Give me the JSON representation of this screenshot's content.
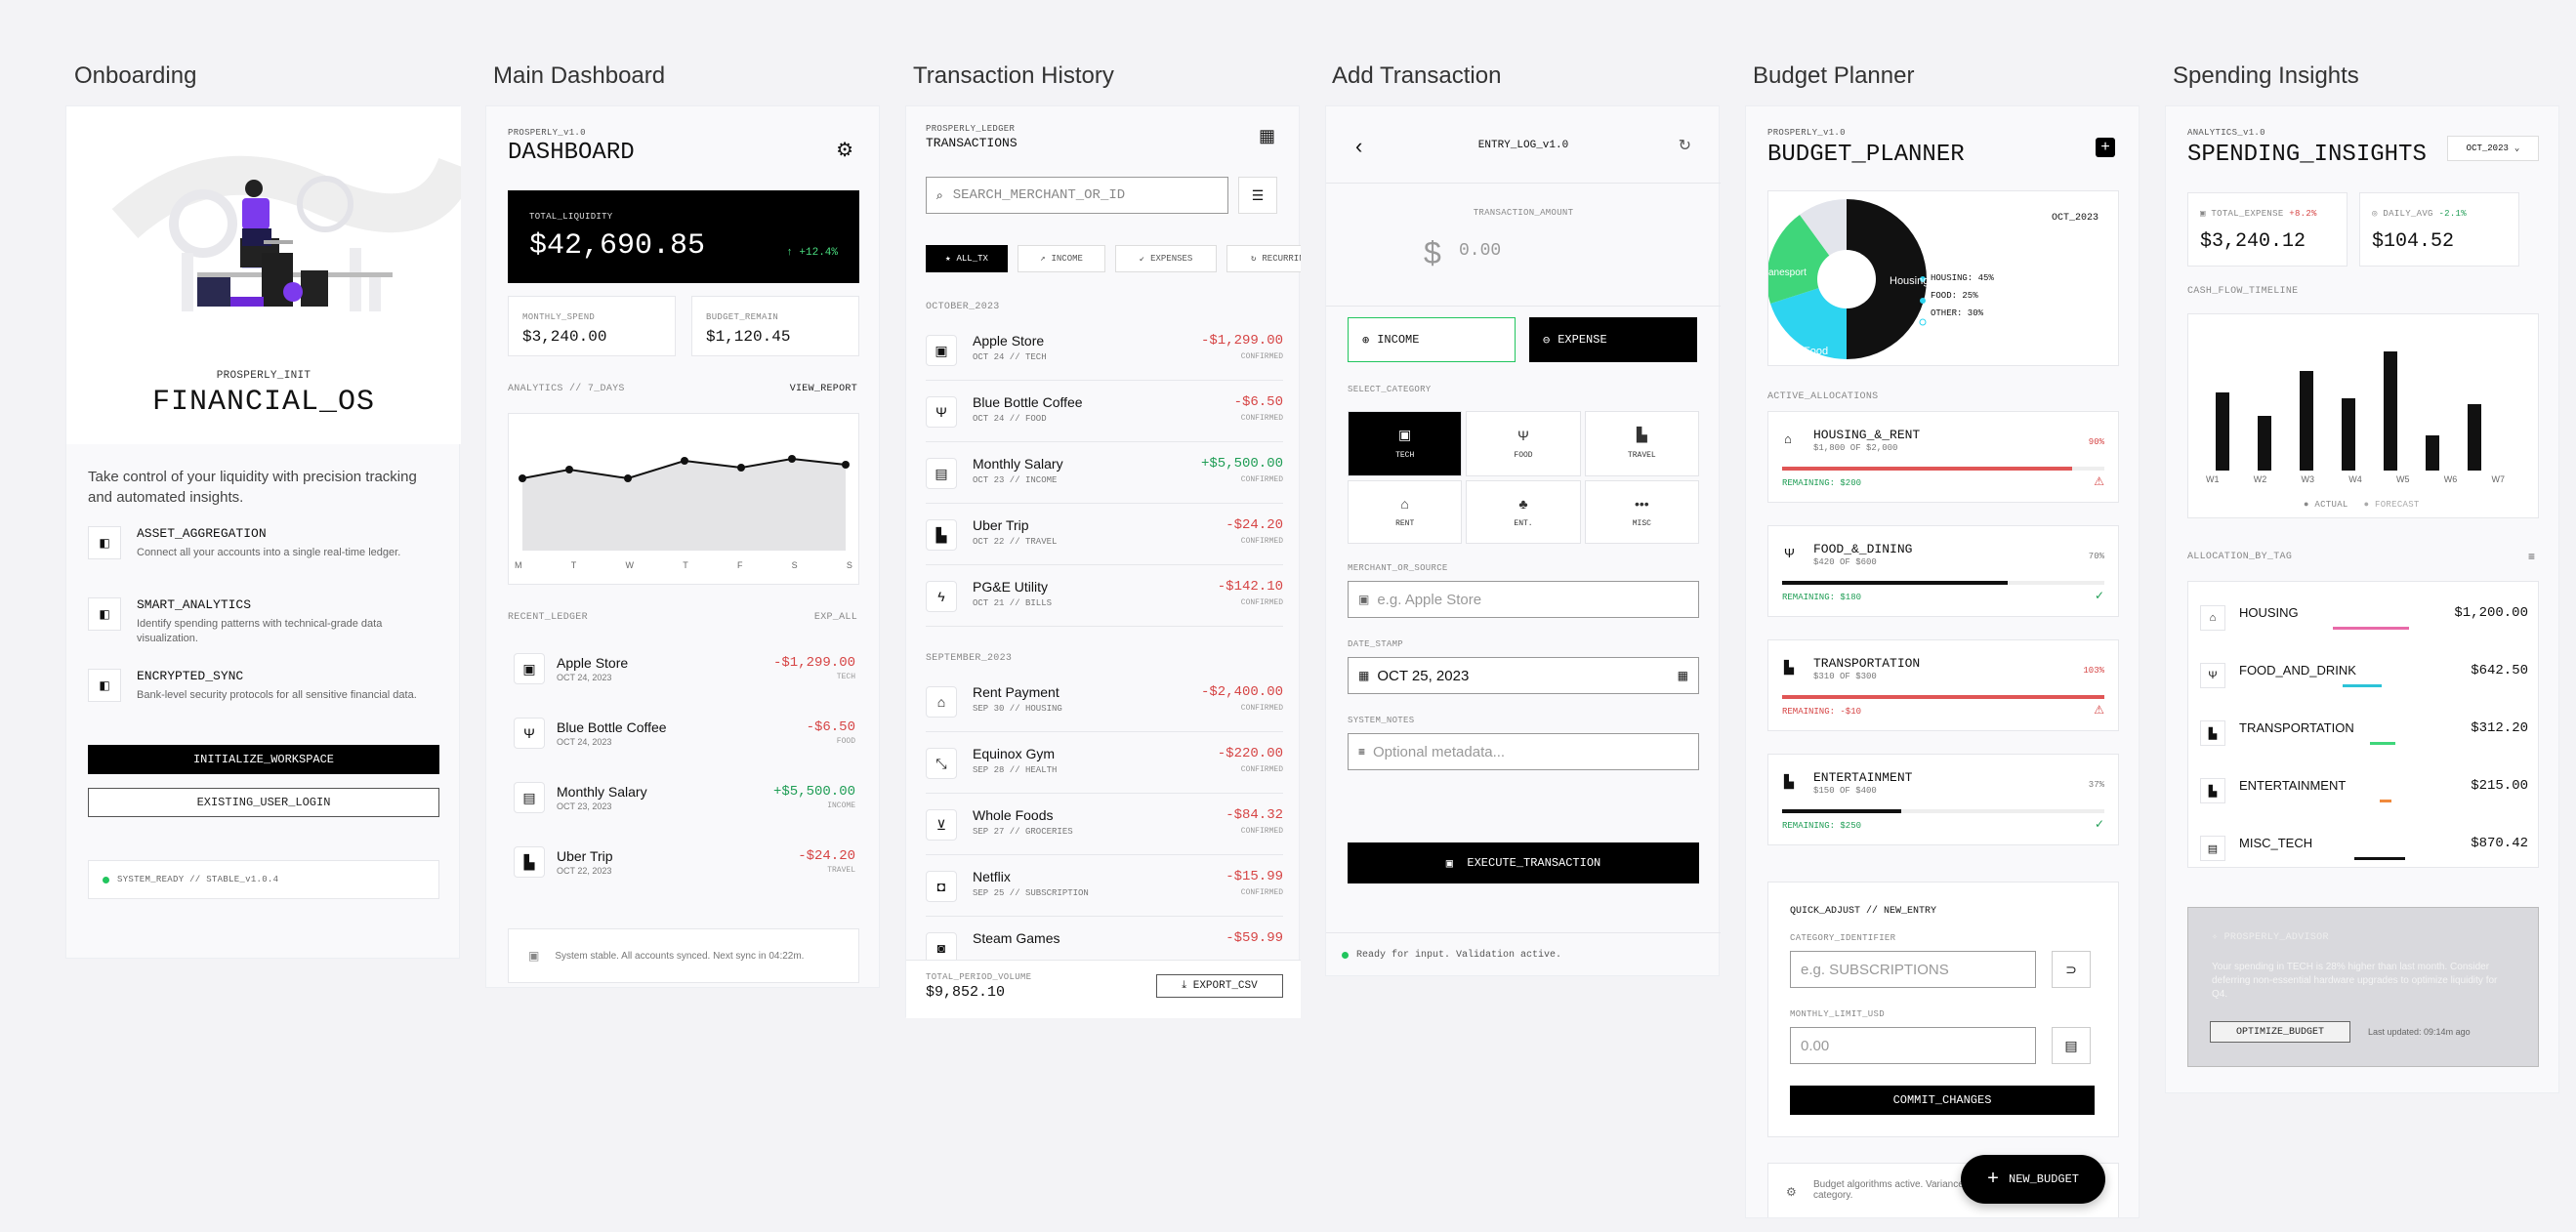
{
  "columns": {
    "onboarding": "Onboarding",
    "dashboard": "Main Dashboard",
    "history": "Transaction History",
    "add": "Add Transaction",
    "budget": "Budget Planner",
    "insights": "Spending Insights"
  },
  "onboarding": {
    "init_label": "PROSPERLY_INIT",
    "title": "FINANCIAL_OS",
    "intro": "Take control of your liquidity with precision tracking and automated insights.",
    "features": [
      {
        "icon": "wallet-icon",
        "title": "ASSET_AGGREGATION",
        "desc": "Connect all your accounts into a single real-time ledger."
      },
      {
        "icon": "chart-icon",
        "title": "SMART_ANALYTICS",
        "desc": "Identify spending patterns with technical-grade data visualization."
      },
      {
        "icon": "shield-icon",
        "title": "ENCRYPTED_SYNC",
        "desc": "Bank-level security protocols for all sensitive financial data."
      }
    ],
    "primary_btn": "INITIALIZE_WORKSPACE",
    "secondary_btn": "EXISTING_USER_LOGIN",
    "status": "SYSTEM_READY // STABLE_v1.0.4"
  },
  "dashboard": {
    "brand": "PROSPERLY_v1.0",
    "title": "DASHBOARD",
    "liq_label": "TOTAL_LIQUIDITY",
    "liq_value": "$42,690.85",
    "liq_change": "+12.4%",
    "spend_label": "MONTHLY_SPEND",
    "spend_value": "$3,240.00",
    "remain_label": "BUDGET_REMAIN",
    "remain_value": "$1,120.45",
    "analytics_label": "ANALYTICS // 7_DAYS",
    "view_report": "VIEW_REPORT",
    "days": [
      "M",
      "T",
      "W",
      "T",
      "F",
      "S",
      "S"
    ],
    "ledger_label": "RECENT_LEDGER",
    "exp_all": "EXP_ALL",
    "ledger": [
      {
        "icon": "bag-icon",
        "glyph": "▣",
        "name": "Apple Store",
        "date": "OCT 24, 2023",
        "amount": "-$1,299.00",
        "tag": "TECH",
        "neg": true
      },
      {
        "icon": "utensils-icon",
        "glyph": "Ψ",
        "name": "Blue Bottle Coffee",
        "date": "OCT 24, 2023",
        "amount": "-$6.50",
        "tag": "FOOD",
        "neg": true
      },
      {
        "icon": "money-icon",
        "glyph": "▤",
        "name": "Monthly Salary",
        "date": "OCT 23, 2023",
        "amount": "+$5,500.00",
        "tag": "INCOME",
        "neg": false
      },
      {
        "icon": "car-icon",
        "glyph": "▙",
        "name": "Uber Trip",
        "date": "OCT 22, 2023",
        "amount": "-$24.20",
        "tag": "TRAVEL",
        "neg": true
      }
    ],
    "footer": "System stable. All accounts synced. Next sync in 04:22m."
  },
  "history": {
    "brand": "PROSPERLY_LEDGER",
    "title": "TRANSACTIONS",
    "search_placeholder": "SEARCH_MERCHANT_OR_ID",
    "filters": [
      "ALL_TX",
      "INCOME",
      "EXPENSES",
      "RECURRING"
    ],
    "oct_label": "OCTOBER_2023",
    "oct": [
      {
        "glyph": "▣",
        "name": "Apple Store",
        "date": "OCT 24 // TECH",
        "amount": "-$1,299.00",
        "status": "CONFIRMED",
        "neg": true
      },
      {
        "glyph": "Ψ",
        "name": "Blue Bottle Coffee",
        "date": "OCT 24 // FOOD",
        "amount": "-$6.50",
        "status": "CONFIRMED",
        "neg": true
      },
      {
        "glyph": "▤",
        "name": "Monthly Salary",
        "date": "OCT 23 // INCOME",
        "amount": "+$5,500.00",
        "status": "CONFIRMED",
        "neg": false
      },
      {
        "glyph": "▙",
        "name": "Uber Trip",
        "date": "OCT 22 // TRAVEL",
        "amount": "-$24.20",
        "status": "CONFIRMED",
        "neg": true
      },
      {
        "glyph": "ϟ",
        "name": "PG&E Utility",
        "date": "OCT 21 // BILLS",
        "amount": "-$142.10",
        "status": "CONFIRMED",
        "neg": true
      }
    ],
    "sep_label": "SEPTEMBER_2023",
    "sep": [
      {
        "glyph": "⌂",
        "name": "Rent Payment",
        "date": "SEP 30 // HOUSING",
        "amount": "-$2,400.00",
        "status": "CONFIRMED",
        "neg": true
      },
      {
        "glyph": "⤡",
        "name": "Equinox Gym",
        "date": "SEP 28 // HEALTH",
        "amount": "-$220.00",
        "status": "CONFIRMED",
        "neg": true
      },
      {
        "glyph": "⊻",
        "name": "Whole Foods",
        "date": "SEP 27 // GROCERIES",
        "amount": "-$84.32",
        "status": "CONFIRMED",
        "neg": true
      },
      {
        "glyph": "◘",
        "name": "Netflix",
        "date": "SEP 25 // SUBSCRIPTION",
        "amount": "-$15.99",
        "status": "CONFIRMED",
        "neg": true
      },
      {
        "glyph": "◙",
        "name": "Steam Games",
        "date": "",
        "amount": "-$59.99",
        "status": "",
        "neg": true
      }
    ],
    "total_label": "TOTAL_PERIOD_VOLUME",
    "total_value": "$9,852.10",
    "export": "EXPORT_CSV"
  },
  "add": {
    "title": "ENTRY_LOG_v1.0",
    "amount_label": "TRANSACTION_AMOUNT",
    "currency": "$",
    "amount_placeholder": "0.00",
    "income": "INCOME",
    "expense": "EXPENSE",
    "category_label": "SELECT_CATEGORY",
    "categories": [
      {
        "glyph": "▣",
        "label": "TECH"
      },
      {
        "glyph": "Ψ",
        "label": "FOOD"
      },
      {
        "glyph": "▙",
        "label": "TRAVEL"
      },
      {
        "glyph": "⌂",
        "label": "RENT"
      },
      {
        "glyph": "♣",
        "label": "ENT."
      },
      {
        "glyph": "•••",
        "label": "MISC"
      }
    ],
    "merchant_label": "MERCHANT_OR_SOURCE",
    "merchant_placeholder": "e.g. Apple Store",
    "date_label": "DATE_STAMP",
    "date_value": "OCT 25, 2023",
    "notes_label": "SYSTEM_NOTES",
    "notes_placeholder": "Optional metadata...",
    "execute": "EXECUTE_TRANSACTION",
    "status": "Ready for input. Validation active."
  },
  "budget": {
    "brand": "PROSPERLY_v1.0",
    "title": "BUDGET_PLANNER",
    "period": "OCT_2023",
    "legend": [
      "HOUSING: 45%",
      "FOOD: 25%",
      "OTHER: 30%"
    ],
    "pie_labels": [
      "Housing",
      "Food",
      "anesport"
    ],
    "alloc_label": "ACTIVE_ALLOCATIONS",
    "allocations": [
      {
        "glyph": "⌂",
        "name": "HOUSING_&_RENT",
        "sub": "$1,800 OF $2,000",
        "pct": "90%",
        "pct_val": 0.9,
        "remaining": "REMAINING: $200",
        "color": "#e05555",
        "over": false
      },
      {
        "glyph": "Ψ",
        "name": "FOOD_&_DINING",
        "sub": "$420 OF $600",
        "pct": "70%",
        "pct_val": 0.7,
        "remaining": "REMAINING: $180",
        "color": "#111111",
        "over": false
      },
      {
        "glyph": "▙",
        "name": "TRANSPORTATION",
        "sub": "$310 OF $300",
        "pct": "103%",
        "pct_val": 1.0,
        "remaining": "REMAINING: -$10",
        "color": "#e05555",
        "over": true
      },
      {
        "glyph": "▙",
        "name": "ENTERTAINMENT",
        "sub": "$150 OF $400",
        "pct": "37%",
        "pct_val": 0.37,
        "remaining": "REMAINING: $250",
        "color": "#111111",
        "over": false
      }
    ],
    "quick_label": "QUICK_ADJUST // NEW_ENTRY",
    "cat_label": "CATEGORY_IDENTIFIER",
    "cat_placeholder": "e.g. SUBSCRIPTIONS",
    "limit_label": "MONTHLY_LIMIT_USD",
    "limit_placeholder": "0.00",
    "commit": "COMMIT_CHANGES",
    "footer": "Budget algorithms active. Variance d... category.",
    "new_budget": "NEW_BUDGET"
  },
  "insights": {
    "brand": "ANALYTICS_v1.0",
    "title": "SPENDING_INSIGHTS",
    "period": "OCT_2023",
    "expense_label": "TOTAL_EXPENSE",
    "expense_change": "+8.2%",
    "expense_value": "$3,240.12",
    "avg_label": "DAILY_AVG",
    "avg_change": "-2.1%",
    "avg_value": "$104.52",
    "timeline_label": "CASH_FLOW_TIMELINE",
    "weeks": [
      "W1",
      "W2",
      "W3",
      "W4",
      "W5",
      "W6",
      "W7"
    ],
    "actual": "ACTUAL",
    "forecast": "FORECAST",
    "tag_label": "ALLOCATION_BY_TAG",
    "tags": [
      {
        "glyph": "⌂",
        "name": "HOUSING",
        "value": "$1,200.00",
        "color": "#e86aa8"
      },
      {
        "glyph": "Ψ",
        "name": "FOOD_AND_DRINK",
        "value": "$642.50",
        "color": "#2cc3d8"
      },
      {
        "glyph": "▙",
        "name": "TRANSPORTATION",
        "value": "$312.20",
        "color": "#3fd67a"
      },
      {
        "glyph": "▙",
        "name": "ENTERTAINMENT",
        "value": "$215.00",
        "color": "#f08a3c"
      },
      {
        "glyph": "▤",
        "name": "MISC_TECH",
        "value": "$870.42",
        "color": "#111111"
      }
    ],
    "advisor_label": "PROSPERLY_ADVISOR",
    "advisor_text": "Your spending in TECH is 28% higher than last month. Consider deferring non-essential hardware upgrades to optimize liquidity for Q4.",
    "optimize": "OPTIMIZE_BUDGET",
    "updated": "Last updated: 09:14m ago"
  }
}
